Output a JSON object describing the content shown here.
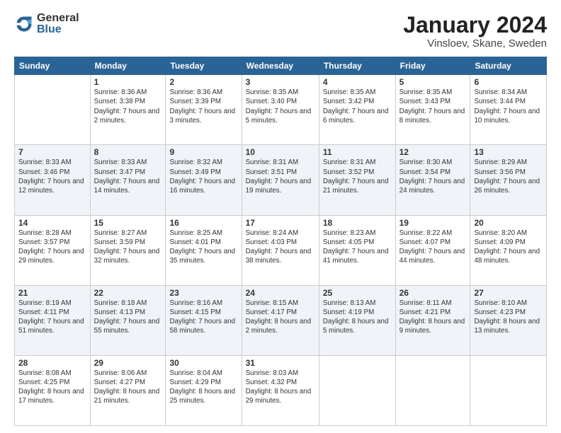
{
  "header": {
    "logo_general": "General",
    "logo_blue": "Blue",
    "title": "January 2024",
    "location": "Vinsloev, Skane, Sweden"
  },
  "days_of_week": [
    "Sunday",
    "Monday",
    "Tuesday",
    "Wednesday",
    "Thursday",
    "Friday",
    "Saturday"
  ],
  "weeks": [
    [
      {
        "day": "",
        "sunrise": "",
        "sunset": "",
        "daylight": ""
      },
      {
        "day": "1",
        "sunrise": "Sunrise: 8:36 AM",
        "sunset": "Sunset: 3:38 PM",
        "daylight": "Daylight: 7 hours and 2 minutes."
      },
      {
        "day": "2",
        "sunrise": "Sunrise: 8:36 AM",
        "sunset": "Sunset: 3:39 PM",
        "daylight": "Daylight: 7 hours and 3 minutes."
      },
      {
        "day": "3",
        "sunrise": "Sunrise: 8:35 AM",
        "sunset": "Sunset: 3:40 PM",
        "daylight": "Daylight: 7 hours and 5 minutes."
      },
      {
        "day": "4",
        "sunrise": "Sunrise: 8:35 AM",
        "sunset": "Sunset: 3:42 PM",
        "daylight": "Daylight: 7 hours and 6 minutes."
      },
      {
        "day": "5",
        "sunrise": "Sunrise: 8:35 AM",
        "sunset": "Sunset: 3:43 PM",
        "daylight": "Daylight: 7 hours and 8 minutes."
      },
      {
        "day": "6",
        "sunrise": "Sunrise: 8:34 AM",
        "sunset": "Sunset: 3:44 PM",
        "daylight": "Daylight: 7 hours and 10 minutes."
      }
    ],
    [
      {
        "day": "7",
        "sunrise": "Sunrise: 8:33 AM",
        "sunset": "Sunset: 3:46 PM",
        "daylight": "Daylight: 7 hours and 12 minutes."
      },
      {
        "day": "8",
        "sunrise": "Sunrise: 8:33 AM",
        "sunset": "Sunset: 3:47 PM",
        "daylight": "Daylight: 7 hours and 14 minutes."
      },
      {
        "day": "9",
        "sunrise": "Sunrise: 8:32 AM",
        "sunset": "Sunset: 3:49 PM",
        "daylight": "Daylight: 7 hours and 16 minutes."
      },
      {
        "day": "10",
        "sunrise": "Sunrise: 8:31 AM",
        "sunset": "Sunset: 3:51 PM",
        "daylight": "Daylight: 7 hours and 19 minutes."
      },
      {
        "day": "11",
        "sunrise": "Sunrise: 8:31 AM",
        "sunset": "Sunset: 3:52 PM",
        "daylight": "Daylight: 7 hours and 21 minutes."
      },
      {
        "day": "12",
        "sunrise": "Sunrise: 8:30 AM",
        "sunset": "Sunset: 3:54 PM",
        "daylight": "Daylight: 7 hours and 24 minutes."
      },
      {
        "day": "13",
        "sunrise": "Sunrise: 8:29 AM",
        "sunset": "Sunset: 3:56 PM",
        "daylight": "Daylight: 7 hours and 26 minutes."
      }
    ],
    [
      {
        "day": "14",
        "sunrise": "Sunrise: 8:28 AM",
        "sunset": "Sunset: 3:57 PM",
        "daylight": "Daylight: 7 hours and 29 minutes."
      },
      {
        "day": "15",
        "sunrise": "Sunrise: 8:27 AM",
        "sunset": "Sunset: 3:59 PM",
        "daylight": "Daylight: 7 hours and 32 minutes."
      },
      {
        "day": "16",
        "sunrise": "Sunrise: 8:25 AM",
        "sunset": "Sunset: 4:01 PM",
        "daylight": "Daylight: 7 hours and 35 minutes."
      },
      {
        "day": "17",
        "sunrise": "Sunrise: 8:24 AM",
        "sunset": "Sunset: 4:03 PM",
        "daylight": "Daylight: 7 hours and 38 minutes."
      },
      {
        "day": "18",
        "sunrise": "Sunrise: 8:23 AM",
        "sunset": "Sunset: 4:05 PM",
        "daylight": "Daylight: 7 hours and 41 minutes."
      },
      {
        "day": "19",
        "sunrise": "Sunrise: 8:22 AM",
        "sunset": "Sunset: 4:07 PM",
        "daylight": "Daylight: 7 hours and 44 minutes."
      },
      {
        "day": "20",
        "sunrise": "Sunrise: 8:20 AM",
        "sunset": "Sunset: 4:09 PM",
        "daylight": "Daylight: 7 hours and 48 minutes."
      }
    ],
    [
      {
        "day": "21",
        "sunrise": "Sunrise: 8:19 AM",
        "sunset": "Sunset: 4:11 PM",
        "daylight": "Daylight: 7 hours and 51 minutes."
      },
      {
        "day": "22",
        "sunrise": "Sunrise: 8:18 AM",
        "sunset": "Sunset: 4:13 PM",
        "daylight": "Daylight: 7 hours and 55 minutes."
      },
      {
        "day": "23",
        "sunrise": "Sunrise: 8:16 AM",
        "sunset": "Sunset: 4:15 PM",
        "daylight": "Daylight: 7 hours and 58 minutes."
      },
      {
        "day": "24",
        "sunrise": "Sunrise: 8:15 AM",
        "sunset": "Sunset: 4:17 PM",
        "daylight": "Daylight: 8 hours and 2 minutes."
      },
      {
        "day": "25",
        "sunrise": "Sunrise: 8:13 AM",
        "sunset": "Sunset: 4:19 PM",
        "daylight": "Daylight: 8 hours and 5 minutes."
      },
      {
        "day": "26",
        "sunrise": "Sunrise: 8:11 AM",
        "sunset": "Sunset: 4:21 PM",
        "daylight": "Daylight: 8 hours and 9 minutes."
      },
      {
        "day": "27",
        "sunrise": "Sunrise: 8:10 AM",
        "sunset": "Sunset: 4:23 PM",
        "daylight": "Daylight: 8 hours and 13 minutes."
      }
    ],
    [
      {
        "day": "28",
        "sunrise": "Sunrise: 8:08 AM",
        "sunset": "Sunset: 4:25 PM",
        "daylight": "Daylight: 8 hours and 17 minutes."
      },
      {
        "day": "29",
        "sunrise": "Sunrise: 8:06 AM",
        "sunset": "Sunset: 4:27 PM",
        "daylight": "Daylight: 8 hours and 21 minutes."
      },
      {
        "day": "30",
        "sunrise": "Sunrise: 8:04 AM",
        "sunset": "Sunset: 4:29 PM",
        "daylight": "Daylight: 8 hours and 25 minutes."
      },
      {
        "day": "31",
        "sunrise": "Sunrise: 8:03 AM",
        "sunset": "Sunset: 4:32 PM",
        "daylight": "Daylight: 8 hours and 29 minutes."
      },
      {
        "day": "",
        "sunrise": "",
        "sunset": "",
        "daylight": ""
      },
      {
        "day": "",
        "sunrise": "",
        "sunset": "",
        "daylight": ""
      },
      {
        "day": "",
        "sunrise": "",
        "sunset": "",
        "daylight": ""
      }
    ]
  ]
}
